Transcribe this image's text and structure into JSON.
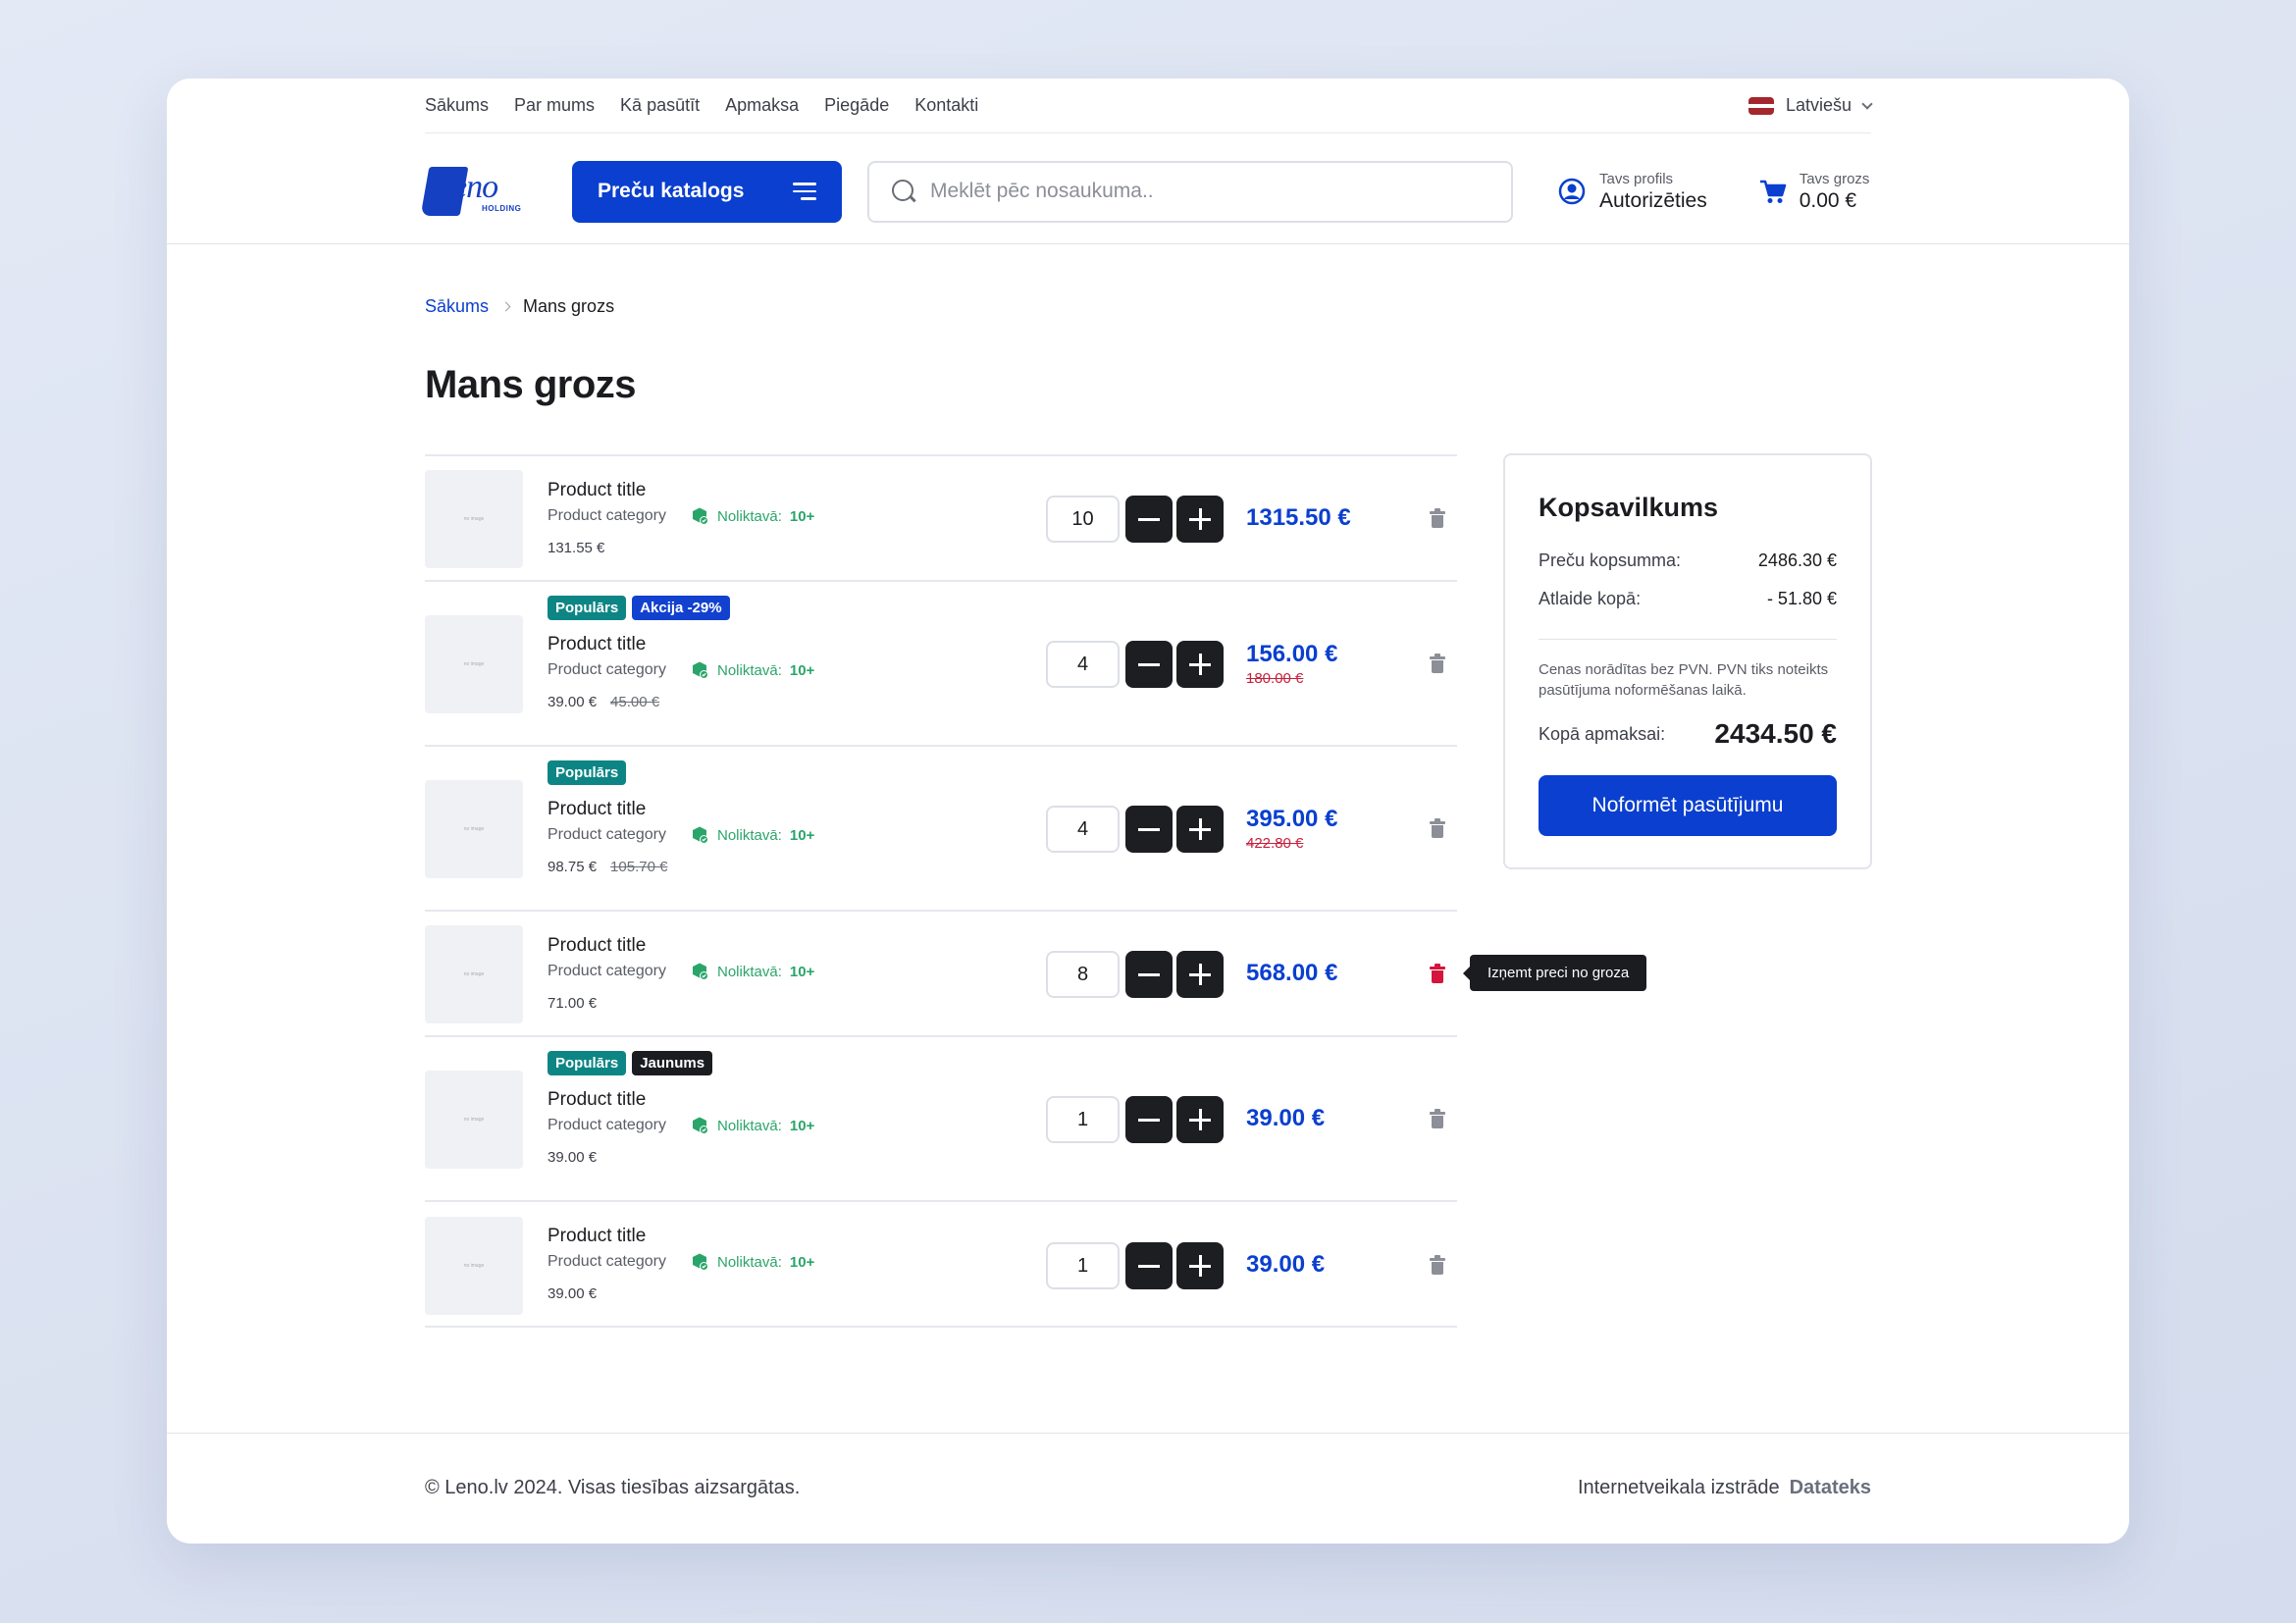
{
  "topnav": {
    "links": [
      "Sākums",
      "Par mums",
      "Kā pasūtīt",
      "Apmaksa",
      "Piegāde",
      "Kontakti"
    ],
    "language": "Latviešu"
  },
  "header": {
    "logo_text": "eno",
    "logo_sub": "HOLDING",
    "catalog_label": "Preču katalogs",
    "search_placeholder": "Meklēt pēc nosaukuma..",
    "profile_small": "Tavs profils",
    "profile_label": "Autorizēties",
    "cart_small": "Tavs grozs",
    "cart_total": "0.00 €"
  },
  "breadcrumb": {
    "home": "Sākums",
    "current": "Mans grozs"
  },
  "page_title": "Mans grozs",
  "stock_label": "Noliktavā:",
  "items": [
    {
      "badges": [],
      "title": "Product title",
      "category": "Product category",
      "stock": "10+",
      "unit_price": "131.55 €",
      "unit_old": "",
      "qty": "10",
      "total": "1315.50 €",
      "total_old": ""
    },
    {
      "badges": [
        {
          "label": "Populārs",
          "kind": "teal"
        },
        {
          "label": "Akcija -29%",
          "kind": "blue"
        }
      ],
      "title": "Product title",
      "category": "Product category",
      "stock": "10+",
      "unit_price": "39.00 €",
      "unit_old": "45.00 €",
      "qty": "4",
      "total": "156.00 €",
      "total_old": "180.00 €"
    },
    {
      "badges": [
        {
          "label": "Populārs",
          "kind": "teal"
        }
      ],
      "title": "Product title",
      "category": "Product category",
      "stock": "10+",
      "unit_price": "98.75 €",
      "unit_old": "105.70 €",
      "qty": "4",
      "total": "395.00 €",
      "total_old": "422.80 €"
    },
    {
      "badges": [],
      "title": "Product title",
      "category": "Product category",
      "stock": "10+",
      "unit_price": "71.00 €",
      "unit_old": "",
      "qty": "8",
      "total": "568.00 €",
      "total_old": "",
      "hover": true
    },
    {
      "badges": [
        {
          "label": "Populārs",
          "kind": "teal"
        },
        {
          "label": "Jaunums",
          "kind": "dark"
        }
      ],
      "title": "Product title",
      "category": "Product category",
      "stock": "10+",
      "unit_price": "39.00 €",
      "unit_old": "",
      "qty": "1",
      "total": "39.00 €",
      "total_old": ""
    },
    {
      "badges": [],
      "title": "Product title",
      "category": "Product category",
      "stock": "10+",
      "unit_price": "39.00 €",
      "unit_old": "",
      "qty": "1",
      "total": "39.00 €",
      "total_old": ""
    }
  ],
  "remove_tooltip": "Izņemt preci no groza",
  "thumb_placeholder": "no image",
  "summary": {
    "title": "Kopsavilkums",
    "subtotal_label": "Preču kopsumma:",
    "subtotal_value": "2486.30 €",
    "discount_label": "Atlaide kopā:",
    "discount_value": "- 51.80 €",
    "vat_note": "Cenas norādītas bez PVN. PVN tiks noteikts pasūtījuma noformēšanas laikā.",
    "total_label": "Kopā apmaksai:",
    "total_value": "2434.50 €",
    "order_button": "Noformēt pasūtījumu"
  },
  "footer": {
    "copyright": "© Leno.lv 2024. Visas tiesības aizsargātas.",
    "dev_label": "Internetveikala izstrāde",
    "dev_brand": "Datateks"
  },
  "colors": {
    "accent": "#0a3fcf",
    "stock": "#2aa56a",
    "danger": "#d4163c",
    "badge_teal": "#0e8585",
    "badge_blue": "#1241cf",
    "badge_dark": "#1b1c20"
  }
}
